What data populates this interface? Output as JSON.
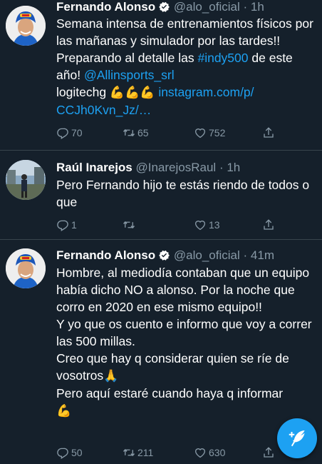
{
  "colors": {
    "background": "#15202b",
    "link": "#1da1f2",
    "muted": "#8899a6",
    "divider": "#38444d"
  },
  "tweets": [
    {
      "name": "Fernando Alonso",
      "verified": true,
      "handle": "@alo_oficial",
      "separator": "·",
      "time": "1h",
      "body": [
        {
          "type": "text",
          "text": "Semana intensa de entrenamientos físicos por las mañanas y simulador por las tardes!!  Preparando al detalle las "
        },
        {
          "type": "link",
          "text": "#indy500"
        },
        {
          "type": "text",
          "text": " de este año! "
        },
        {
          "type": "link",
          "text": "@Allinsports_srl"
        },
        {
          "type": "text",
          "text": "\nlogitechg "
        },
        {
          "type": "emoji",
          "text": "💪💪💪"
        },
        {
          "type": "text",
          "text": " "
        },
        {
          "type": "link",
          "text": "instagram.com/p/\nCCJh0Kvn_Jz/…"
        }
      ],
      "replies": "70",
      "retweets": "65",
      "likes": "752",
      "avatar_icon": "driver-helmet-avatar"
    },
    {
      "name": "Raúl Inarejos",
      "verified": false,
      "handle": "@InarejosRaul",
      "separator": "·",
      "time": "1h",
      "body": [
        {
          "type": "text",
          "text": "Pero Fernando hijo te estás riendo de todos o que"
        }
      ],
      "replies": "1",
      "retweets": "",
      "likes": "13",
      "avatar_icon": "person-outdoor-avatar"
    },
    {
      "name": "Fernando Alonso",
      "verified": true,
      "handle": "@alo_oficial",
      "separator": "·",
      "time": "41m",
      "body": [
        {
          "type": "text",
          "text": "Hombre, al mediodía contaban que un equipo había dicho NO a alonso. Por la noche que corro en 2020 en ese mismo equipo!!\nY yo que os cuento e informo que voy a correr las 500 millas.\nCreo que hay q considerar quien se ríe de vosotros"
        },
        {
          "type": "emoji",
          "text": "🙏"
        },
        {
          "type": "text",
          "text": "\nPero aquí estaré cuando haya q informar\n"
        },
        {
          "type": "emoji",
          "text": "💪"
        }
      ],
      "replies": "50",
      "retweets": "211",
      "likes": "630",
      "avatar_icon": "driver-helmet-avatar"
    }
  ],
  "compose_button": {
    "icon": "compose-feather-icon"
  }
}
